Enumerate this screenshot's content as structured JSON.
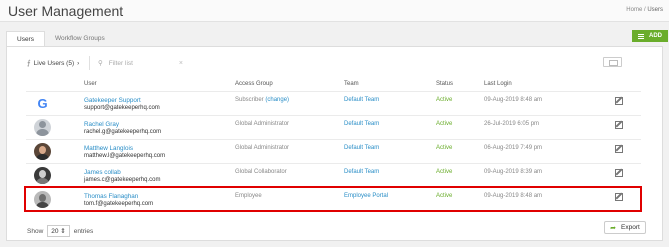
{
  "header": {
    "title": "User Management",
    "breadcrumb": {
      "home": "Home",
      "separator": "/",
      "current": "Users"
    }
  },
  "tabs": [
    {
      "label": "Users",
      "active": true
    },
    {
      "label": "Workflow Groups",
      "active": false
    }
  ],
  "actions": {
    "add_label": "ADD"
  },
  "filter": {
    "label": "Live Users (5)",
    "chevron": "›",
    "search_placeholder": "Filter list",
    "clear": "×"
  },
  "table": {
    "columns": [
      "User",
      "Access Group",
      "Team",
      "Status",
      "Last Login"
    ],
    "rows": [
      {
        "avatar": "google-logo",
        "name": "Gatekeeper Support",
        "email": "support@gatekeeperhq.com",
        "access_group": "Subscriber",
        "access_change": "(change)",
        "team": "Default Team",
        "status": "Active",
        "last_login": "09-Aug-2019 8:48 am"
      },
      {
        "avatar": "placeholder-avatar",
        "name": "Rachel Gray",
        "email": "rachel.g@gatekeeperhq.com",
        "access_group": "Global Administrator",
        "access_change": "",
        "team": "Default Team",
        "status": "Active",
        "last_login": "26-Jul-2019 6:05 pm"
      },
      {
        "avatar": "user-photo",
        "name": "Matthew Langlois",
        "email": "matthew.l@gatekeeperhq.com",
        "access_group": "Global Administrator",
        "access_change": "",
        "team": "Default Team",
        "status": "Active",
        "last_login": "06-Aug-2019 7:49 pm"
      },
      {
        "avatar": "user-photo",
        "name": "James collab",
        "email": "james.c@gatekeeperhq.com",
        "access_group": "Global Collaborator",
        "access_change": "",
        "team": "Default Team",
        "status": "Active",
        "last_login": "09-Aug-2019 8:39 am"
      },
      {
        "avatar": "user-photo",
        "name": "Thomas Flanaghan",
        "email": "tom.f@gatekeeperhq.com",
        "access_group": "Employee",
        "access_change": "",
        "team": "Employee Portal",
        "status": "Active",
        "last_login": "09-Aug-2019 8:48 am"
      }
    ]
  },
  "footer": {
    "show_label": "Show",
    "page_size": "20",
    "entries_label": "entries",
    "export_label": "Export"
  },
  "colors": {
    "accent": "#6aad2b",
    "link": "#2a8ec7",
    "highlight": "#e00000"
  }
}
